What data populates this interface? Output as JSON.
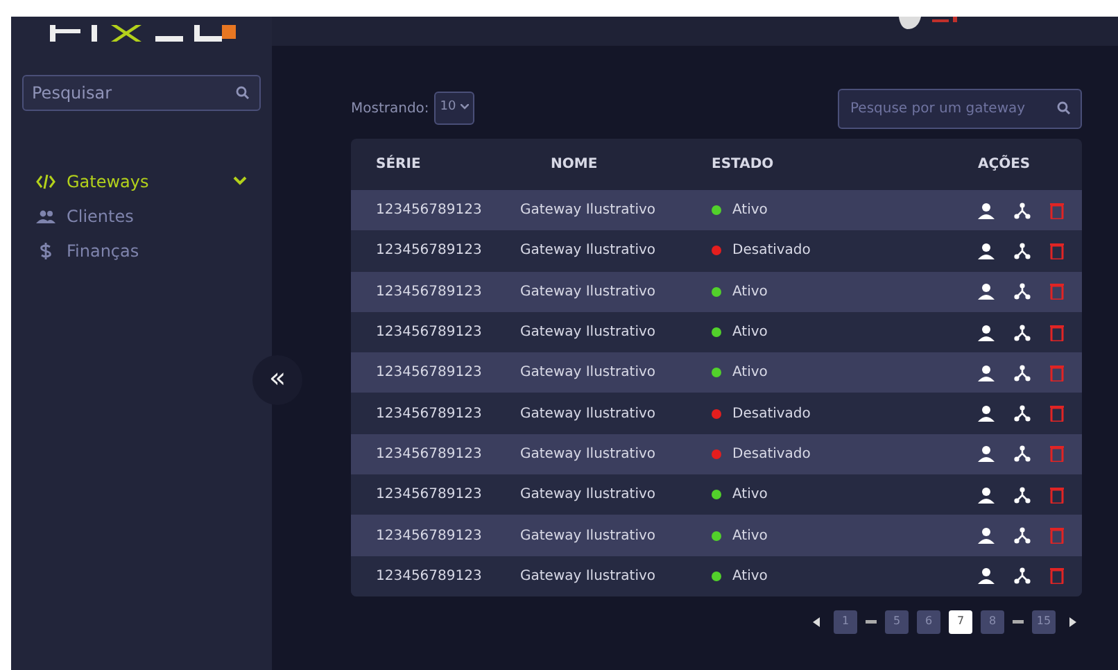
{
  "sidebar": {
    "search": {
      "placeholder": "Pesquisar"
    },
    "items": [
      {
        "label": "Gateways",
        "selected": true,
        "expanded": true
      },
      {
        "label": "Clientes",
        "selected": false
      },
      {
        "label": "Finanças",
        "selected": false
      }
    ],
    "collapse_button": "«"
  },
  "toolbar": {
    "showing_label": "Mostrando:",
    "page_size": "10",
    "search": {
      "placeholder": "Pesquse por um gateway"
    }
  },
  "table": {
    "columns": [
      "SÉRIE",
      "NOME",
      "ESTADO",
      "AÇÕES"
    ],
    "rows": [
      {
        "serial": "123456789123",
        "name": "Gateway Ilustrativo",
        "status": "Ativo",
        "active": true
      },
      {
        "serial": "123456789123",
        "name": "Gateway Ilustrativo",
        "status": "Desativado",
        "active": false
      },
      {
        "serial": "123456789123",
        "name": "Gateway Ilustrativo",
        "status": "Ativo",
        "active": true
      },
      {
        "serial": "123456789123",
        "name": "Gateway Ilustrativo",
        "status": "Ativo",
        "active": true
      },
      {
        "serial": "123456789123",
        "name": "Gateway Ilustrativo",
        "status": "Ativo",
        "active": true
      },
      {
        "serial": "123456789123",
        "name": "Gateway Ilustrativo",
        "status": "Desativado",
        "active": false
      },
      {
        "serial": "123456789123",
        "name": "Gateway Ilustrativo",
        "status": "Desativado",
        "active": false
      },
      {
        "serial": "123456789123",
        "name": "Gateway Ilustrativo",
        "status": "Ativo",
        "active": true
      },
      {
        "serial": "123456789123",
        "name": "Gateway Ilustrativo",
        "status": "Ativo",
        "active": true
      },
      {
        "serial": "123456789123",
        "name": "Gateway Ilustrativo",
        "status": "Ativo",
        "active": true
      }
    ]
  },
  "pagination": [
    {
      "kind": "prev"
    },
    {
      "kind": "page",
      "label": "1",
      "selected": false
    },
    {
      "kind": "gap"
    },
    {
      "kind": "page",
      "label": "5",
      "selected": false
    },
    {
      "kind": "page",
      "label": "6",
      "selected": false
    },
    {
      "kind": "page",
      "label": "7",
      "selected": true
    },
    {
      "kind": "page",
      "label": "8",
      "selected": false
    },
    {
      "kind": "gap"
    },
    {
      "kind": "page",
      "label": "15",
      "selected": false
    },
    {
      "kind": "next"
    }
  ]
}
